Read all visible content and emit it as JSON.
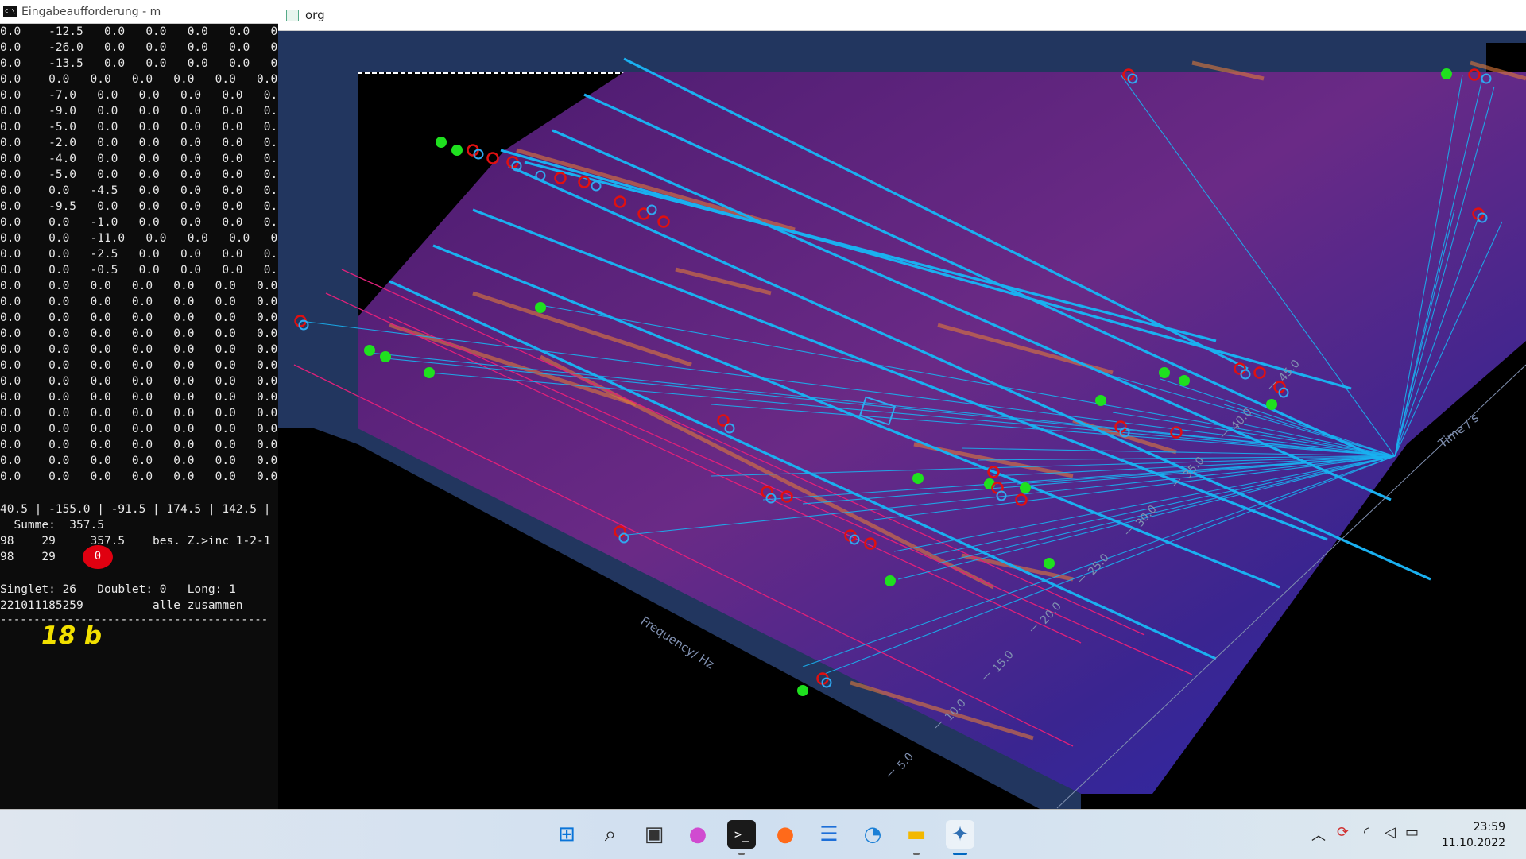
{
  "console": {
    "title": "Eingabeaufforderung - m",
    "icon": "cmd-icon",
    "rows": [
      "0.0    -12.5   0.0   0.0   0.0   0.0   0",
      "0.0    -26.0   0.0   0.0   0.0   0.0   0.",
      "0.0    -13.5   0.0   0.0   0.0   0.0   0.",
      "0.0    0.0   0.0   0.0   0.0   0.0   0.0",
      "0.0    -7.0   0.0   0.0   0.0   0.0   0.",
      "0.0    -9.0   0.0   0.0   0.0   0.0   0.",
      "0.0    -5.0   0.0   0.0   0.0   0.0   0.",
      "0.0    -2.0   0.0   0.0   0.0   0.0   0.",
      "0.0    -4.0   0.0   0.0   0.0   0.0   0.",
      "0.0    -5.0   0.0   0.0   0.0   0.0   0.",
      "0.0    0.0   -4.5   0.0   0.0   0.0   0.",
      "0.0    -9.5   0.0   0.0   0.0   0.0   0.",
      "0.0    0.0   -1.0   0.0   0.0   0.0   0.",
      "0.0    0.0   -11.0   0.0   0.0   0.0   0",
      "0.0    0.0   -2.5   0.0   0.0   0.0   0.",
      "0.0    0.0   -0.5   0.0   0.0   0.0   0.",
      "0.0    0.0   0.0   0.0   0.0   0.0   0.0",
      "0.0    0.0   0.0   0.0   0.0   0.0   0.0",
      "0.0    0.0   0.0   0.0   0.0   0.0   0.0",
      "0.0    0.0   0.0   0.0   0.0   0.0   0.0",
      "0.0    0.0   0.0   0.0   0.0   0.0   0.0",
      "0.0    0.0   0.0   0.0   0.0   0.0   0.0",
      "0.0    0.0   0.0   0.0   0.0   0.0   0.0",
      "0.0    0.0   0.0   0.0   0.0   0.0   0.0",
      "0.0    0.0   0.0   0.0   0.0   0.0   0.0",
      "0.0    0.0   0.0   0.0   0.0   0.0   0.0",
      "0.0    0.0   0.0   0.0   0.0   0.0   0.0",
      "0.0    0.0   0.0   0.0   0.0   0.0   0.0",
      "0.0    0.0   0.0   0.0   0.0   0.0   0.0"
    ],
    "summary_line": "40.5 | -155.0 | -91.5 | 174.5 | 142.5 |",
    "sum_line": "  Summe:  357.5",
    "line_a": "98    29     357.5    bes. Z.>inc 1-2-1",
    "line_b": "98    29",
    "circled_value": "0",
    "stats_line": "Singlet: 26   Doublet: 0   Long: 1",
    "id_line": "221011185259          alle zusammen",
    "dashes": "----------------------------------------",
    "handwritten_note": "18 b"
  },
  "window": {
    "title": "org"
  },
  "plot": {
    "xlabel": "Frequency/ Hz",
    "ylabel": "Time / s",
    "time_ticks": [
      "5.0",
      "10.0",
      "15.0",
      "20.0",
      "25.0",
      "30.0",
      "35.0",
      "40.0",
      "45.0"
    ],
    "colors": {
      "frame": "#22365f",
      "background": "#000000",
      "link_line": "#1ab0f0",
      "marker_green": "#1fe01f",
      "marker_red": "#e01010",
      "marker_blue": "#30a8f0"
    }
  },
  "taskbar": {
    "apps": [
      {
        "name": "start-icon",
        "glyph": "⊞",
        "color": "#0a74d8"
      },
      {
        "name": "search-icon",
        "glyph": "⌕",
        "color": "#222222"
      },
      {
        "name": "task-view-icon",
        "glyph": "▣",
        "color": "#333333"
      },
      {
        "name": "drop-app-icon",
        "glyph": "●",
        "color": "#d04bd0"
      },
      {
        "name": "terminal-icon",
        "glyph": ">_",
        "color": "#ffffff"
      },
      {
        "name": "firefox-icon",
        "glyph": "●",
        "color": "#ff6a1a"
      },
      {
        "name": "notepad-icon",
        "glyph": "☰",
        "color": "#1d6fd8"
      },
      {
        "name": "app-swirl-icon",
        "glyph": "◔",
        "color": "#1b7fd6"
      },
      {
        "name": "file-explorer-icon",
        "glyph": "▬",
        "color": "#f3b800"
      },
      {
        "name": "python-icon",
        "glyph": "✦",
        "color": "#2f6fb3"
      }
    ],
    "clock_time": "23:59",
    "clock_date": "11.10.2022",
    "tray": [
      "chevron-up-icon",
      "sync-icon",
      "wifi-icon",
      "volume-icon",
      "battery-icon"
    ]
  }
}
